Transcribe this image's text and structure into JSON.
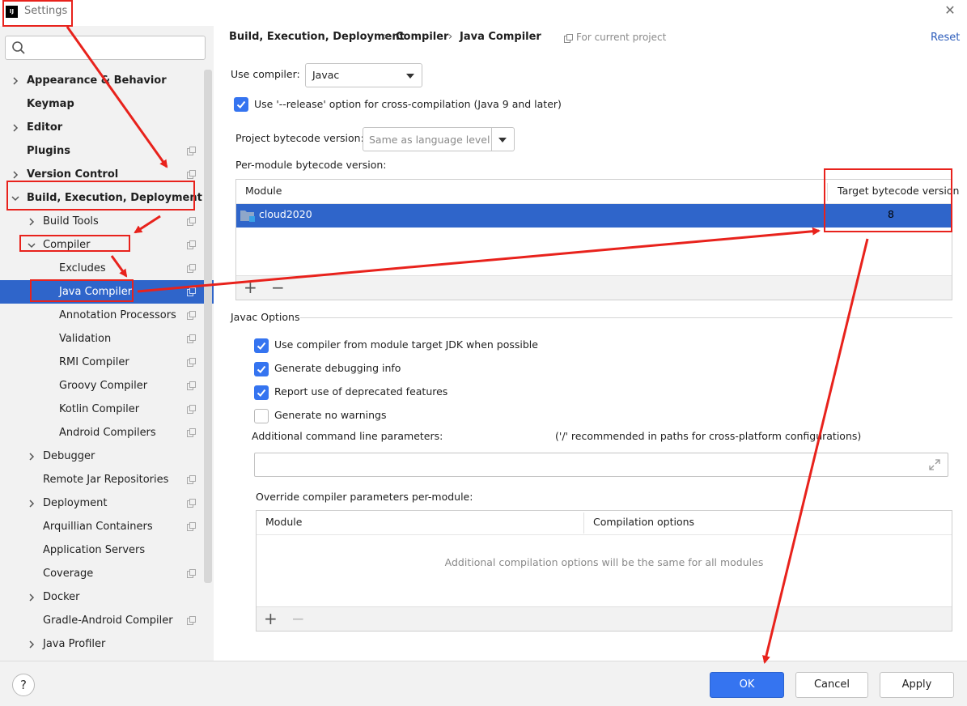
{
  "window": {
    "title": "Settings",
    "logo": "IJ"
  },
  "search": {
    "placeholder": ""
  },
  "sidebar": {
    "items": [
      {
        "label": "Appearance & Behavior"
      },
      {
        "label": "Keymap"
      },
      {
        "label": "Editor"
      },
      {
        "label": "Plugins"
      },
      {
        "label": "Version Control"
      },
      {
        "label": "Build, Execution, Deployment"
      },
      {
        "label": "Build Tools"
      },
      {
        "label": "Compiler"
      },
      {
        "label": "Excludes"
      },
      {
        "label": "Java Compiler"
      },
      {
        "label": "Annotation Processors"
      },
      {
        "label": "Validation"
      },
      {
        "label": "RMI Compiler"
      },
      {
        "label": "Groovy Compiler"
      },
      {
        "label": "Kotlin Compiler"
      },
      {
        "label": "Android Compilers"
      },
      {
        "label": "Debugger"
      },
      {
        "label": "Remote Jar Repositories"
      },
      {
        "label": "Deployment"
      },
      {
        "label": "Arquillian Containers"
      },
      {
        "label": "Application Servers"
      },
      {
        "label": "Coverage"
      },
      {
        "label": "Docker"
      },
      {
        "label": "Gradle-Android Compiler"
      },
      {
        "label": "Java Profiler"
      }
    ]
  },
  "breadcrumb": {
    "items": [
      "Build, Execution, Deployment",
      "Compiler",
      "Java Compiler"
    ],
    "separator": "›",
    "scope": "For current project"
  },
  "reset_label": "Reset",
  "compiler": {
    "use_compiler_label": "Use compiler:",
    "use_compiler_value": "Javac",
    "release_option_label": "Use '--release' option for cross-compilation (Java 9 and later)",
    "project_bytecode_label": "Project bytecode version:",
    "project_bytecode_value": "Same as language level",
    "per_module_label": "Per-module bytecode version:"
  },
  "module_table": {
    "col_module": "Module",
    "col_target": "Target bytecode version",
    "rows": [
      {
        "module": "cloud2020",
        "target": "8"
      }
    ],
    "add": "+",
    "remove": "−"
  },
  "javac": {
    "section_label": "Javac Options",
    "options": [
      {
        "label": "Use compiler from module target JDK when possible",
        "checked": true
      },
      {
        "label": "Generate debugging info",
        "checked": true
      },
      {
        "label": "Report use of deprecated features",
        "checked": true
      },
      {
        "label": "Generate no warnings",
        "checked": false
      }
    ],
    "additional_params_label": "Additional command line parameters:",
    "additional_params_hint": "('/' recommended in paths for cross-platform configurations)",
    "additional_params_value": "",
    "override_label": "Override compiler parameters per-module:"
  },
  "override_table": {
    "col_module": "Module",
    "col_options": "Compilation options",
    "empty_text": "Additional compilation options will be the same for all modules",
    "add": "+",
    "remove": "−"
  },
  "footer": {
    "help": "?",
    "ok": "OK",
    "cancel": "Cancel",
    "apply": "Apply"
  },
  "colors": {
    "accent": "#3574f0",
    "selection": "#2f65ca",
    "annotation": "#e8221c",
    "link": "#2d5dbb"
  }
}
